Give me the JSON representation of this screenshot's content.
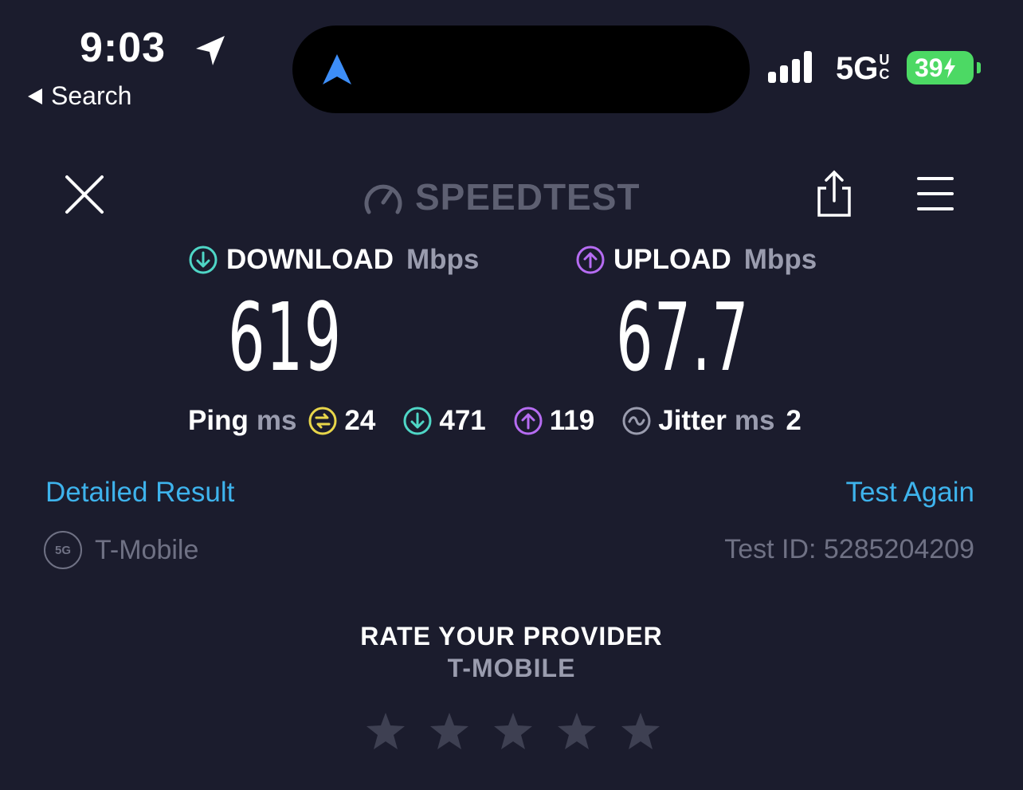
{
  "status_bar": {
    "time": "9:03",
    "back_label": "Search",
    "network": "5G",
    "network_suffix_top": "U",
    "network_suffix_bottom": "C",
    "battery": "39"
  },
  "header": {
    "logo_text": "SPEEDTEST",
    "icons": [
      "close-icon",
      "speedometer-icon",
      "share-icon",
      "hamburger-menu-icon"
    ]
  },
  "download": {
    "label": "DOWNLOAD",
    "unit": "Mbps",
    "value": "619"
  },
  "upload": {
    "label": "UPLOAD",
    "unit": "Mbps",
    "value": "67.7"
  },
  "stats": {
    "ping_label": "Ping",
    "ping_unit": "ms",
    "idle_ping": "24",
    "download_ping": "471",
    "upload_ping": "119",
    "jitter_label": "Jitter",
    "jitter_unit": "ms",
    "jitter": "2"
  },
  "links": {
    "detailed": "Detailed Result",
    "test_again": "Test Again"
  },
  "provider": {
    "badge": "5G",
    "name": "T-Mobile",
    "test_id": "Test ID: 5285204209"
  },
  "rate": {
    "title": "RATE YOUR PROVIDER",
    "provider": "T-MOBILE",
    "stars_total": 5,
    "stars_selected": 0
  },
  "colors": {
    "background": "#1b1c2d",
    "download_accent": "#4fd6c6",
    "upload_accent": "#b66cf2",
    "ping_accent": "#e8d64a",
    "link": "#3eb3ec",
    "battery": "#4cd964",
    "island_nav": "#3d8ef8"
  }
}
